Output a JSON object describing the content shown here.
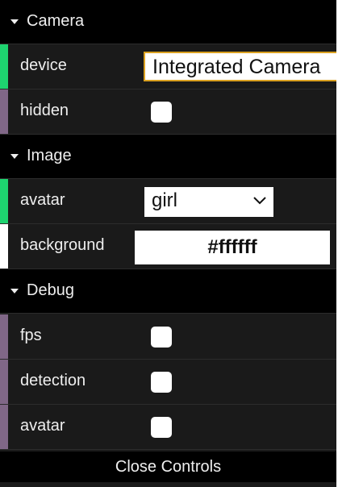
{
  "colors": {
    "panel_bg": "#1a1a1a",
    "folder_bg": "#000000",
    "text": "#eeeeee",
    "string_stripe": "#1ed36f",
    "boolean_stripe": "#806787",
    "color_stripe": "#ffffff",
    "focus_border": "#d9a020"
  },
  "folders": {
    "camera": {
      "title": "Camera",
      "device": {
        "label": "device",
        "value": "Integrated Camera"
      },
      "hidden": {
        "label": "hidden",
        "checked": false
      }
    },
    "image": {
      "title": "Image",
      "avatar": {
        "label": "avatar",
        "value": "girl"
      },
      "background": {
        "label": "background",
        "value": "#ffffff"
      }
    },
    "debug": {
      "title": "Debug",
      "fps": {
        "label": "fps",
        "checked": false
      },
      "detection": {
        "label": "detection",
        "checked": false
      },
      "avatar": {
        "label": "avatar",
        "checked": false
      }
    }
  },
  "close_label": "Close Controls"
}
